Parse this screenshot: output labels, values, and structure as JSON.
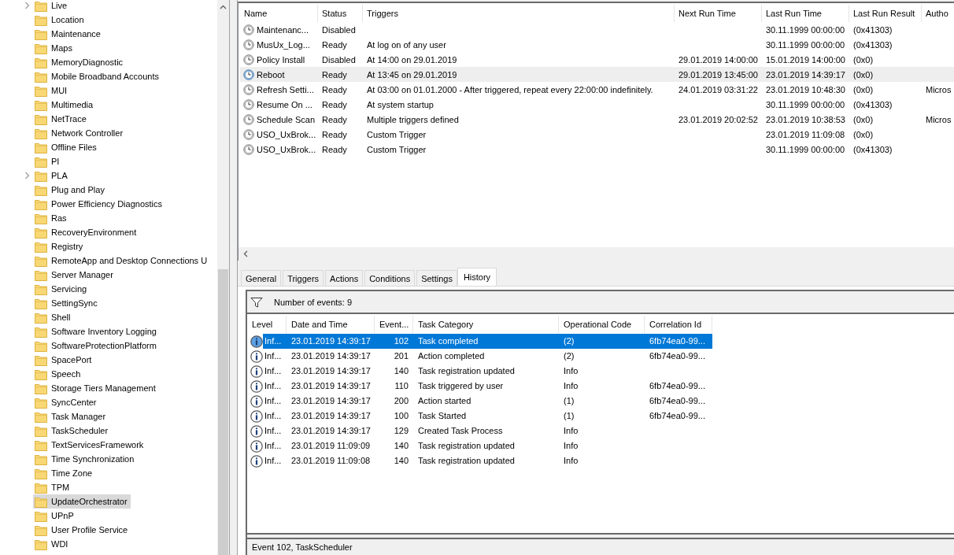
{
  "tree": {
    "items": [
      {
        "label": "Live",
        "expandable": true,
        "selected": false
      },
      {
        "label": "Location",
        "expandable": false,
        "selected": false
      },
      {
        "label": "Maintenance",
        "expandable": false,
        "selected": false
      },
      {
        "label": "Maps",
        "expandable": false,
        "selected": false
      },
      {
        "label": "MemoryDiagnostic",
        "expandable": false,
        "selected": false
      },
      {
        "label": "Mobile Broadband Accounts",
        "expandable": false,
        "selected": false
      },
      {
        "label": "MUI",
        "expandable": false,
        "selected": false
      },
      {
        "label": "Multimedia",
        "expandable": false,
        "selected": false
      },
      {
        "label": "NetTrace",
        "expandable": false,
        "selected": false
      },
      {
        "label": "Network Controller",
        "expandable": false,
        "selected": false
      },
      {
        "label": "Offline Files",
        "expandable": false,
        "selected": false
      },
      {
        "label": "PI",
        "expandable": false,
        "selected": false
      },
      {
        "label": "PLA",
        "expandable": true,
        "selected": false
      },
      {
        "label": "Plug and Play",
        "expandable": false,
        "selected": false
      },
      {
        "label": "Power Efficiency Diagnostics",
        "expandable": false,
        "selected": false
      },
      {
        "label": "Ras",
        "expandable": false,
        "selected": false
      },
      {
        "label": "RecoveryEnvironment",
        "expandable": false,
        "selected": false
      },
      {
        "label": "Registry",
        "expandable": false,
        "selected": false
      },
      {
        "label": "RemoteApp and Desktop Connections U",
        "expandable": false,
        "selected": false
      },
      {
        "label": "Server Manager",
        "expandable": false,
        "selected": false
      },
      {
        "label": "Servicing",
        "expandable": false,
        "selected": false
      },
      {
        "label": "SettingSync",
        "expandable": false,
        "selected": false
      },
      {
        "label": "Shell",
        "expandable": false,
        "selected": false
      },
      {
        "label": "Software Inventory Logging",
        "expandable": false,
        "selected": false
      },
      {
        "label": "SoftwareProtectionPlatform",
        "expandable": false,
        "selected": false
      },
      {
        "label": "SpacePort",
        "expandable": false,
        "selected": false
      },
      {
        "label": "Speech",
        "expandable": false,
        "selected": false
      },
      {
        "label": "Storage Tiers Management",
        "expandable": false,
        "selected": false
      },
      {
        "label": "SyncCenter",
        "expandable": false,
        "selected": false
      },
      {
        "label": "Task Manager",
        "expandable": false,
        "selected": false
      },
      {
        "label": "TaskScheduler",
        "expandable": false,
        "selected": false
      },
      {
        "label": "TextServicesFramework",
        "expandable": false,
        "selected": false
      },
      {
        "label": "Time Synchronization",
        "expandable": false,
        "selected": false
      },
      {
        "label": "Time Zone",
        "expandable": false,
        "selected": false
      },
      {
        "label": "TPM",
        "expandable": false,
        "selected": false
      },
      {
        "label": "UpdateOrchestrator",
        "expandable": false,
        "selected": true
      },
      {
        "label": "UPnP",
        "expandable": false,
        "selected": false
      },
      {
        "label": "User Profile Service",
        "expandable": false,
        "selected": false
      },
      {
        "label": "WDI",
        "expandable": false,
        "selected": false
      }
    ]
  },
  "tasks": {
    "columns": [
      "Name",
      "Status",
      "Triggers",
      "Next Run Time",
      "Last Run Time",
      "Last Run Result",
      "Autho"
    ],
    "rows": [
      {
        "name": "Maintenanc...",
        "status": "Disabled",
        "last_run_time": "30.11.1999 00:00:00",
        "last_run_result": "(0x41303)",
        "selected": false
      },
      {
        "name": "MusUx_Log...",
        "status": "Ready",
        "triggers": "At log on of any user",
        "last_run_time": "30.11.1999 00:00:00",
        "last_run_result": "(0x41303)",
        "selected": false
      },
      {
        "name": "Policy Install",
        "status": "Disabled",
        "triggers": "At 14:00 on 29.01.2019",
        "next_run_time": "29.01.2019 14:00:00",
        "last_run_time": "15.01.2019 14:00:00",
        "last_run_result": "(0x0)",
        "selected": false
      },
      {
        "name": "Reboot",
        "status": "Ready",
        "triggers": "At 13:45 on 29.01.2019",
        "next_run_time": "29.01.2019 13:45:00",
        "last_run_time": "23.01.2019 14:39:17",
        "last_run_result": "(0x0)",
        "selected": true
      },
      {
        "name": "Refresh Setti...",
        "status": "Ready",
        "triggers": "At 03:00 on 01.01.2000 - After triggered, repeat every 22:00:00 indefinitely.",
        "next_run_time": "24.01.2019 03:31:22",
        "last_run_time": "23.01.2019 10:48:30",
        "last_run_result": "(0x0)",
        "author": "Micros",
        "selected": false
      },
      {
        "name": "Resume On ...",
        "status": "Ready",
        "triggers": "At system startup",
        "last_run_time": "30.11.1999 00:00:00",
        "last_run_result": "(0x41303)",
        "selected": false
      },
      {
        "name": "Schedule Scan",
        "status": "Ready",
        "triggers": "Multiple triggers defined",
        "next_run_time": "23.01.2019 20:02:52",
        "last_run_time": "23.01.2019 10:38:53",
        "last_run_result": "(0x0)",
        "author": "Micros",
        "selected": false
      },
      {
        "name": "USO_UxBrok...",
        "status": "Ready",
        "triggers": "Custom Trigger",
        "last_run_time": "23.01.2019 11:09:08",
        "last_run_result": "(0x0)",
        "selected": false
      },
      {
        "name": "USO_UxBrok...",
        "status": "Ready",
        "triggers": "Custom Trigger",
        "last_run_time": "30.11.1999 00:00:00",
        "last_run_result": "(0x41303)",
        "selected": false
      }
    ]
  },
  "tabs": [
    {
      "label": "General",
      "selected": false
    },
    {
      "label": "Triggers",
      "selected": false
    },
    {
      "label": "Actions",
      "selected": false
    },
    {
      "label": "Conditions",
      "selected": false
    },
    {
      "label": "Settings",
      "selected": false
    },
    {
      "label": "History",
      "selected": true
    }
  ],
  "history": {
    "filter_text": "Number of events: 9",
    "columns": [
      "Level",
      "Date and Time",
      "Event...",
      "Task Category",
      "Operational Code",
      "Correlation Id"
    ],
    "rows": [
      {
        "level": "Inf...",
        "date_time": "23.01.2019 14:39:17",
        "event_id": "102",
        "task_category": "Task completed",
        "operational_code": "(2)",
        "correlation_id": "6fb74ea0-99...",
        "selected": true
      },
      {
        "level": "Inf...",
        "date_time": "23.01.2019 14:39:17",
        "event_id": "201",
        "task_category": "Action completed",
        "operational_code": "(2)",
        "correlation_id": "6fb74ea0-99...",
        "selected": false
      },
      {
        "level": "Inf...",
        "date_time": "23.01.2019 14:39:17",
        "event_id": "140",
        "task_category": "Task registration updated",
        "operational_code": "Info",
        "selected": false
      },
      {
        "level": "Inf...",
        "date_time": "23.01.2019 14:39:17",
        "event_id": "110",
        "task_category": "Task triggered by user",
        "operational_code": "Info",
        "correlation_id": "6fb74ea0-99...",
        "selected": false
      },
      {
        "level": "Inf...",
        "date_time": "23.01.2019 14:39:17",
        "event_id": "200",
        "task_category": "Action started",
        "operational_code": "(1)",
        "correlation_id": "6fb74ea0-99...",
        "selected": false
      },
      {
        "level": "Inf...",
        "date_time": "23.01.2019 14:39:17",
        "event_id": "100",
        "task_category": "Task Started",
        "operational_code": "(1)",
        "correlation_id": "6fb74ea0-99...",
        "selected": false
      },
      {
        "level": "Inf...",
        "date_time": "23.01.2019 14:39:17",
        "event_id": "129",
        "task_category": "Created Task Process",
        "operational_code": "Info",
        "selected": false
      },
      {
        "level": "Inf...",
        "date_time": "23.01.2019 11:09:09",
        "event_id": "140",
        "task_category": "Task registration updated",
        "operational_code": "Info",
        "selected": false
      },
      {
        "level": "Inf...",
        "date_time": "23.01.2019 11:09:08",
        "event_id": "140",
        "task_category": "Task registration updated",
        "operational_code": "Info",
        "selected": false
      }
    ]
  },
  "status_bar": "Event 102, TaskScheduler"
}
